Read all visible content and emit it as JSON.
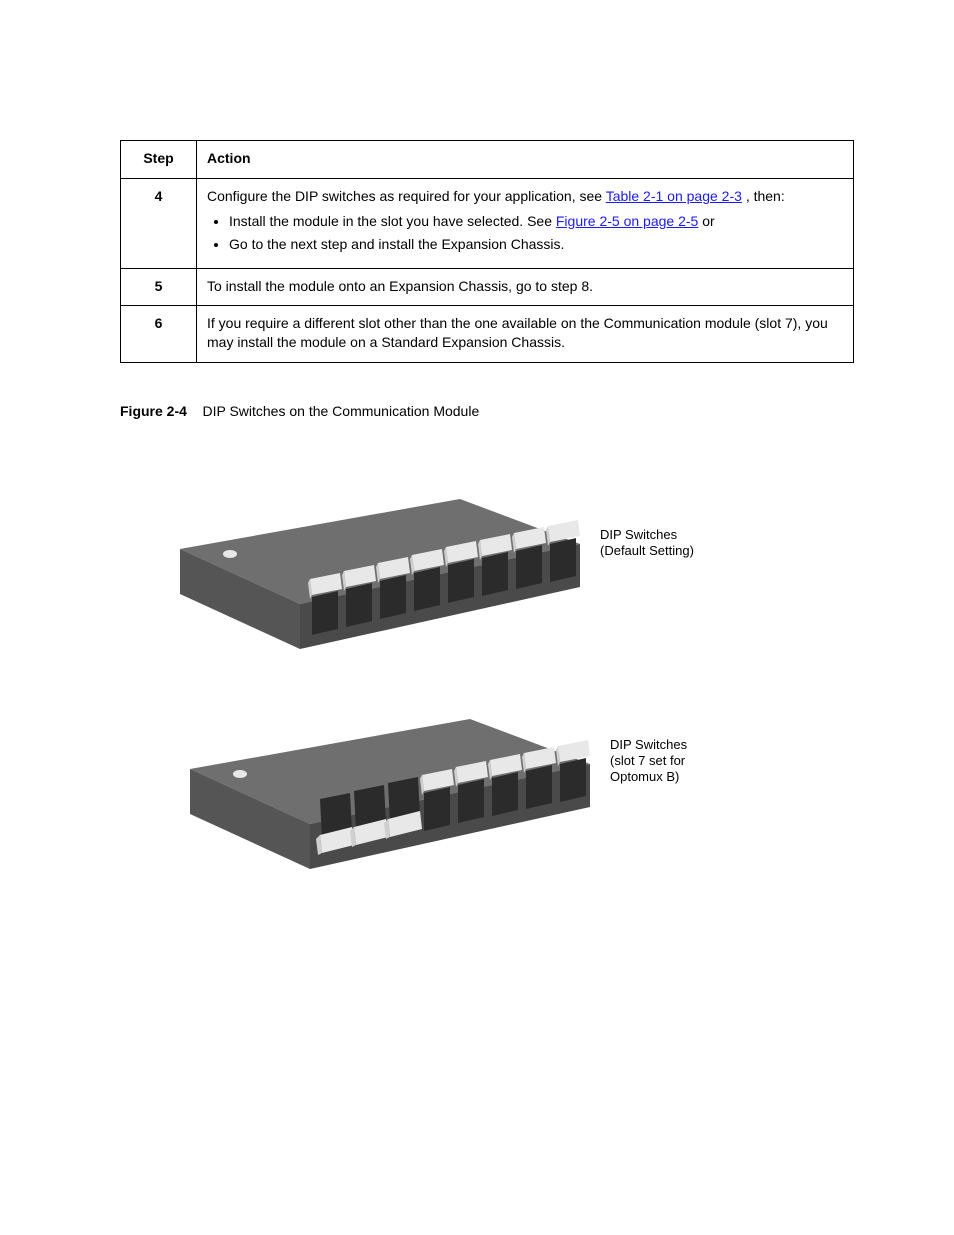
{
  "table": {
    "head_step": "Step",
    "head_action": "Action",
    "rows": [
      {
        "num": "4",
        "pre_text_a": "Configure the DIP switches as required for your application, see ",
        "link1": "Table 2-1 on page 2-3",
        "post_text_a": ", then:",
        "bullet1_pre": "Install the module in the slot you have selected. See ",
        "bullet1_link": "Figure 2-5 on page 2-5",
        "bullet1_post": " or",
        "bullet2": "Go to the next step and install the Expansion Chassis."
      },
      {
        "num": "5",
        "text": "To install the module onto an Expansion Chassis, go to step 8."
      },
      {
        "num": "6",
        "text_a": "If you require a different slot other than the one available on the Communication module (slot 7), you may install the module on a Standard Expansion Chassis."
      }
    ]
  },
  "figure": {
    "caption_label": "Figure 2-4",
    "caption_text": "DIP Switches on the Communication Module",
    "label_top": "DIP Switches\n(Default Setting)",
    "label_bottom": "DIP Switches\n(slot 7 set for\nOptomux B)"
  }
}
